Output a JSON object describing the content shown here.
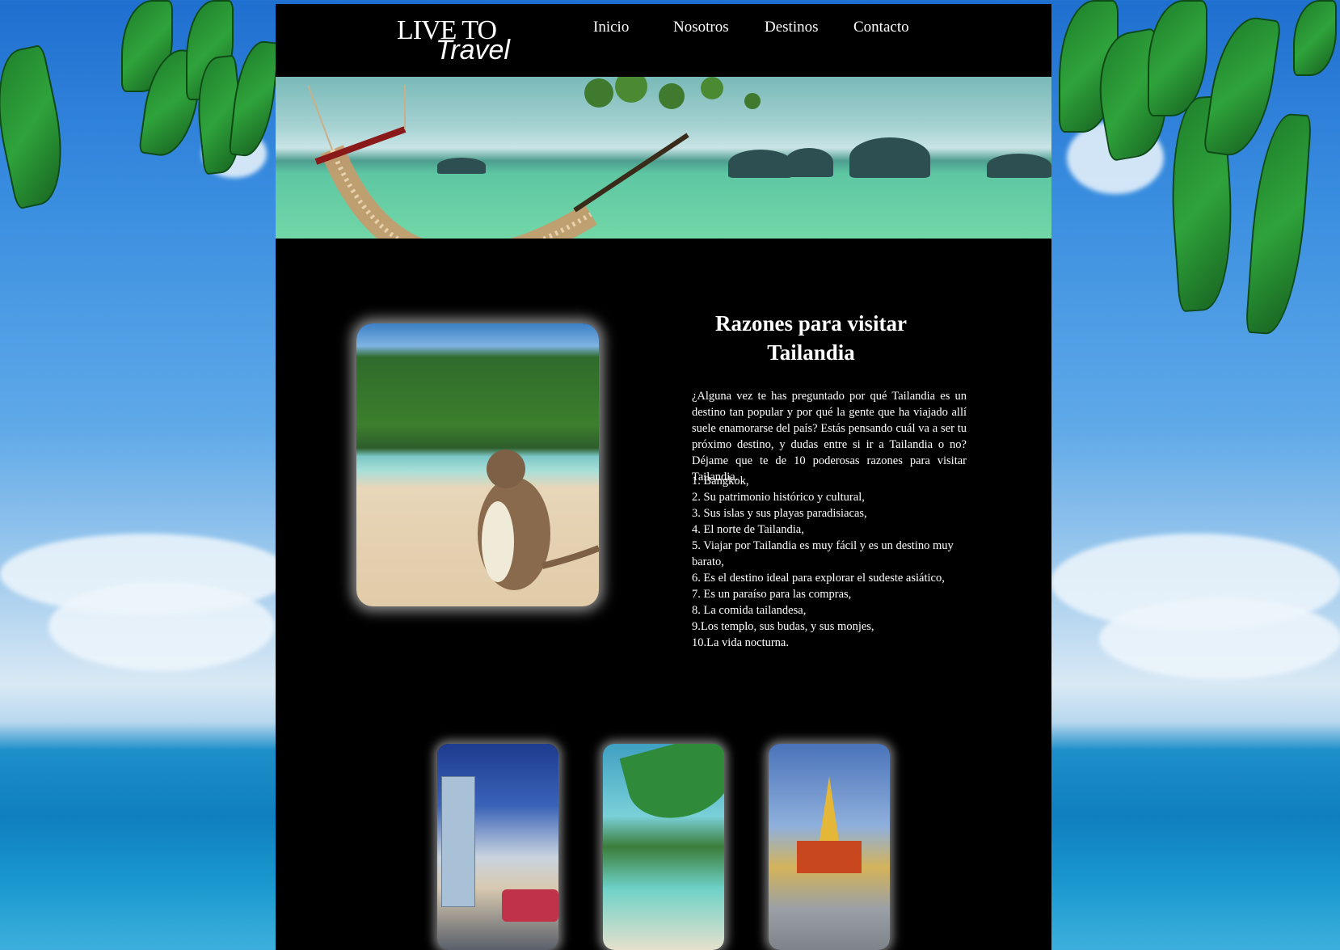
{
  "logo": {
    "line1": "LIVE TO",
    "line2": "Travel"
  },
  "nav": {
    "items": [
      {
        "label": "Inicio"
      },
      {
        "label": "Nosotros"
      },
      {
        "label": "Destinos"
      },
      {
        "label": "Contacto"
      }
    ]
  },
  "article": {
    "title": "Razones para visitar Tailandia",
    "intro": "¿Alguna vez te has preguntado por qué Tailandia es un destino tan popular y por qué la gente que ha viajado allí suele enamorarse del país? Estás pensando cuál va a ser tu próximo destino, y dudas entre si ir a Tailandia o no? Déjame que te de 10 poderosas razones para visitar Tailandia.",
    "reasons": [
      "1. Bangkok,",
      "2. Su patrimonio histórico y cultural,",
      "3. Sus islas y sus playas paradisiacas,",
      "4. El norte de Tailandia,",
      "5. Viajar por Tailandia es muy fácil y es un destino muy barato,",
      "6. Es el destino ideal para explorar el sudeste asiático,",
      "7. Es un paraíso para las compras,",
      "8. La comida tailandesa,",
      "9.Los templo, sus budas, y sus monjes,",
      "10.La vida nocturna."
    ]
  },
  "colors": {
    "page_bg": "#000000",
    "text": "#ffffff"
  }
}
